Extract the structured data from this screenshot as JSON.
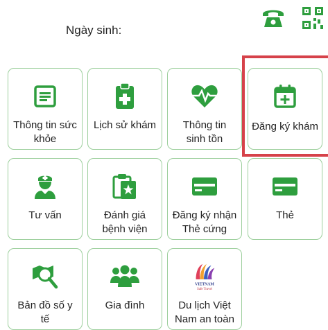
{
  "header": {
    "dob_label": "Ngày sinh:",
    "icons": [
      "phone-icon",
      "qr-code-icon"
    ]
  },
  "tiles": [
    {
      "label": "Thông tin sức\nkhỏe",
      "icon": "health-record-icon"
    },
    {
      "label": "Lịch sử khám",
      "icon": "medical-clipboard-icon"
    },
    {
      "label": "Thông tin\nsinh tồn",
      "icon": "heart-pulse-icon"
    },
    {
      "label": "Đăng ký khám",
      "icon": "calendar-add-icon",
      "highlighted": true
    },
    {
      "label": "Tư vấn",
      "icon": "doctor-icon"
    },
    {
      "label": "Đánh giá\nbệnh viện",
      "icon": "rating-clipboard-icon"
    },
    {
      "label": "Đăng ký nhận\nThẻ cứng",
      "icon": "card-icon"
    },
    {
      "label": "Thẻ",
      "icon": "card-icon"
    },
    {
      "label": "Bản đồ số y\ntế",
      "icon": "map-search-icon"
    },
    {
      "label": "Gia đình",
      "icon": "family-icon"
    },
    {
      "label": "Du lịch Việt\nNam an toàn",
      "icon": "vietnam-travel-logo",
      "logo_text": [
        "VIETNAM",
        "Safe Travel"
      ]
    }
  ],
  "colors": {
    "accent_green": "#2e9e3e",
    "tile_border": "#9ccf9c",
    "highlight": "#d6424a"
  }
}
